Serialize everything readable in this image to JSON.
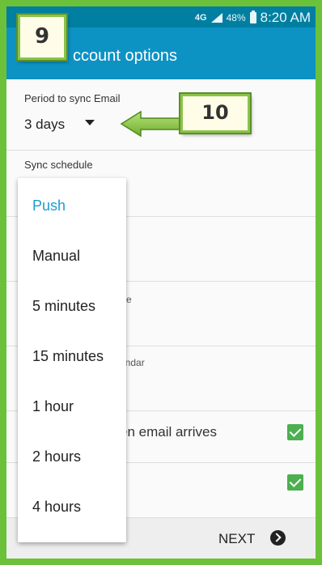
{
  "status_bar": {
    "network": "4G",
    "battery": "48%",
    "time": "8:20 AM"
  },
  "header": {
    "title": "ccount options"
  },
  "annotations": {
    "badge_9": "9",
    "badge_10": "10"
  },
  "settings": {
    "sync_period": {
      "label": "Period to sync Email",
      "value": "3 days"
    },
    "sync_schedule": {
      "label": "Sync schedule"
    },
    "peek_text_e": "e",
    "peek_calendar": "endar",
    "peek_email_arrives": "en email arrives",
    "checkboxes": {
      "email_arrives_checked": true,
      "second_checked": true
    }
  },
  "dropdown": {
    "options": [
      "Push",
      "Manual",
      "5 minutes",
      "15 minutes",
      "1 hour",
      "2 hours",
      "4 hours"
    ],
    "selected": "Push"
  },
  "bottom_bar": {
    "next_label": "NEXT"
  },
  "colors": {
    "status_bar": "#007fa1",
    "action_bar": "#0d92c4",
    "frame_border": "#6cc13b",
    "selected_option": "#1e9bd0",
    "checkbox": "#4caf50"
  }
}
